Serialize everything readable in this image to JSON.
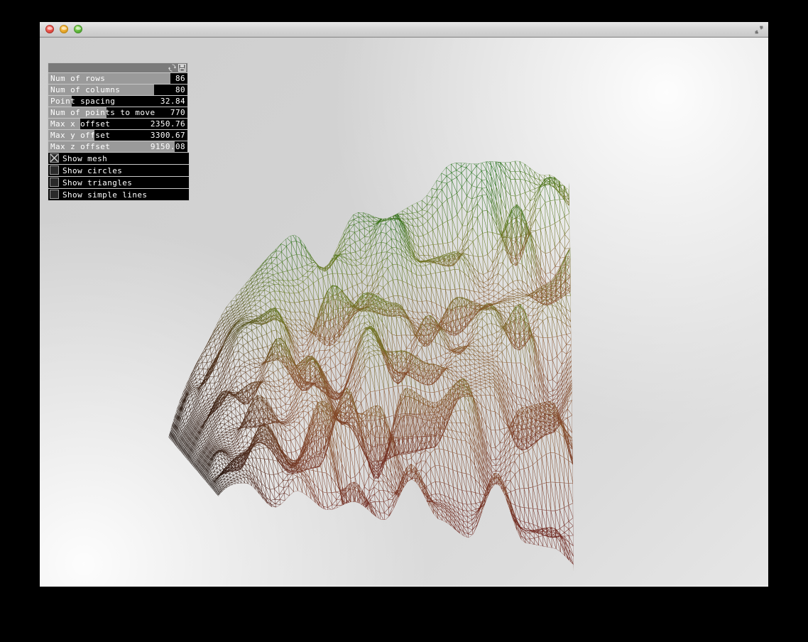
{
  "window": {
    "traffic_lights": [
      "close",
      "minimize",
      "maximize"
    ],
    "fullscreen_icon": "expand-arrows-icon"
  },
  "panel": {
    "header": {
      "refresh_icon": "refresh-icon",
      "save_icon": "save-floppy-icon"
    },
    "sliders": [
      {
        "label": "Num of rows",
        "value": "86",
        "fill_pct": 88
      },
      {
        "label": "Num of columns",
        "value": "80",
        "fill_pct": 76
      },
      {
        "label": "Point spacing",
        "value": "32.84",
        "fill_pct": 17
      },
      {
        "label": "Num of points to move",
        "value": "770",
        "fill_pct": 42
      },
      {
        "label": "Max x offset",
        "value": "2350.76",
        "fill_pct": 23
      },
      {
        "label": "Max y offset",
        "value": "3300.67",
        "fill_pct": 33
      },
      {
        "label": "Max z offset",
        "value": "9150.08",
        "fill_pct": 91
      }
    ],
    "checkboxes": [
      {
        "label": "Show mesh",
        "checked": true
      },
      {
        "label": "Show circles",
        "checked": false
      },
      {
        "label": "Show triangles",
        "checked": false
      },
      {
        "label": "Show simple lines",
        "checked": false
      }
    ]
  },
  "viewport": {
    "mesh": {
      "name": "triangulated-terrain-wireframe",
      "rows": 86,
      "columns": 80,
      "color_top": "#1f6b13",
      "color_mid": "#8a7a30",
      "color_bottom": "#7a2a22",
      "color_left": "#141414",
      "background_light": "#f4f4f4",
      "background_dark": "#cdcdcd"
    }
  }
}
